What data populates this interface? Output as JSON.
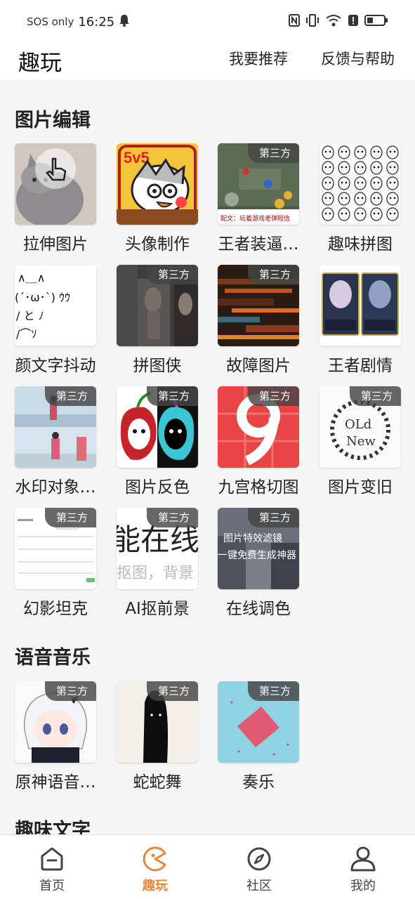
{
  "status_bar": {
    "carrier": "SOS only",
    "time": "16:25"
  },
  "header": {
    "title": "趣玩",
    "recommend_link": "我要推荐",
    "help_link": "反馈与帮助"
  },
  "badge_text": "第三方",
  "sections": [
    {
      "title": "图片编辑",
      "items": [
        {
          "label": "拉伸图片",
          "third_party": false,
          "thumb_icon": "cat-photo-with-pointer-icon"
        },
        {
          "label": "头像制作",
          "third_party": false,
          "thumb_icon": "5v5-cartoon-avatar"
        },
        {
          "label": "王者装逼…",
          "third_party": true,
          "thumb_icon": "game-screenshot"
        },
        {
          "label": "趣味拼图",
          "third_party": false,
          "thumb_icon": "meme-face-grid"
        },
        {
          "label": "颜文字抖动",
          "third_party": false,
          "thumb_icon": "kaomoji"
        },
        {
          "label": "拼图侠",
          "third_party": true,
          "thumb_icon": "dark-photo"
        },
        {
          "label": "故障图片",
          "third_party": true,
          "thumb_icon": "glitch-image"
        },
        {
          "label": "王者剧情",
          "third_party": false,
          "thumb_icon": "hero-cards"
        },
        {
          "label": "水印对象…",
          "third_party": true,
          "thumb_icon": "beach-photos"
        },
        {
          "label": "图片反色",
          "third_party": true,
          "thumb_icon": "inverted-cartoon"
        },
        {
          "label": "九宫格切图",
          "third_party": true,
          "thumb_icon": "nine-grid-logo"
        },
        {
          "label": "图片变旧",
          "third_party": true,
          "thumb_icon": "old-new-wreath"
        },
        {
          "label": "幻影坦克",
          "third_party": true,
          "thumb_icon": "form-screenshot"
        },
        {
          "label": "AI抠前景",
          "third_party": true,
          "thumb_icon": "text-preview"
        },
        {
          "label": "在线调色",
          "third_party": true,
          "thumb_icon": "filter-banner"
        }
      ]
    },
    {
      "title": "语音音乐",
      "items": [
        {
          "label": "原神语音…",
          "third_party": true,
          "thumb_icon": "anime-character"
        },
        {
          "label": "蛇蛇舞",
          "third_party": true,
          "thumb_icon": "black-blob"
        },
        {
          "label": "奏乐",
          "third_party": true,
          "thumb_icon": "pink-square"
        }
      ]
    },
    {
      "title": "趣味文字",
      "items": []
    }
  ],
  "thumb_text": {
    "kaomoji": [
      "∧＿∧",
      "(´･ω･`) ｳｳ",
      "/  と ﾉ",
      "/⌒ｿ"
    ],
    "game_caption": "配文：玩着游戏老弹短信",
    "old_new": [
      "OLd",
      "New"
    ],
    "ai_text": [
      "能在线",
      "抠图，背景"
    ],
    "filter_text": [
      "图片特效滤镜",
      "一键免费生成神器"
    ]
  },
  "bottom_nav": [
    {
      "label": "首页",
      "icon": "home-icon",
      "active": false
    },
    {
      "label": "趣玩",
      "icon": "play-pacman-icon",
      "active": true
    },
    {
      "label": "社区",
      "icon": "compass-icon",
      "active": false
    },
    {
      "label": "我的",
      "icon": "person-icon",
      "active": false
    }
  ],
  "colors": {
    "accent": "#e8863c",
    "badge_bg": "#464646",
    "page_bg": "#f5f5f5"
  }
}
